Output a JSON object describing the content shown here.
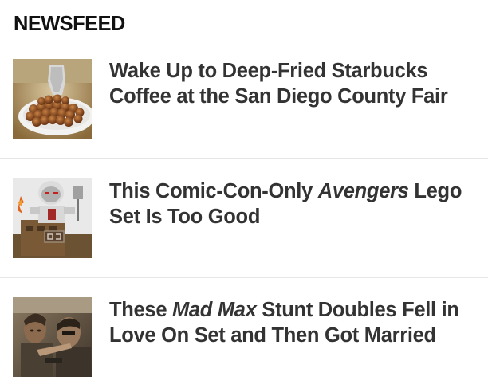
{
  "section": {
    "title": "NEWSFEED"
  },
  "items": [
    {
      "headline_parts": [
        "Wake Up to Deep-Fried Starbucks Coffee at the San Diego County Fair"
      ],
      "image": "deep-fried-coffee-balls-photo"
    },
    {
      "headline_pre": "This Comic-Con-Only ",
      "headline_em": "Avengers",
      "headline_post": " Lego Set Is Too Good",
      "image": "avengers-lego-robot-photo"
    },
    {
      "headline_pre": "These ",
      "headline_em": "Mad Max",
      "headline_post": " Stunt Doubles Fell in Love On Set and Then Got Married",
      "image": "mad-max-stunt-doubles-photo"
    }
  ],
  "colors": {
    "title": "#111111",
    "headline": "#333333",
    "divider": "#e6e6e6"
  }
}
